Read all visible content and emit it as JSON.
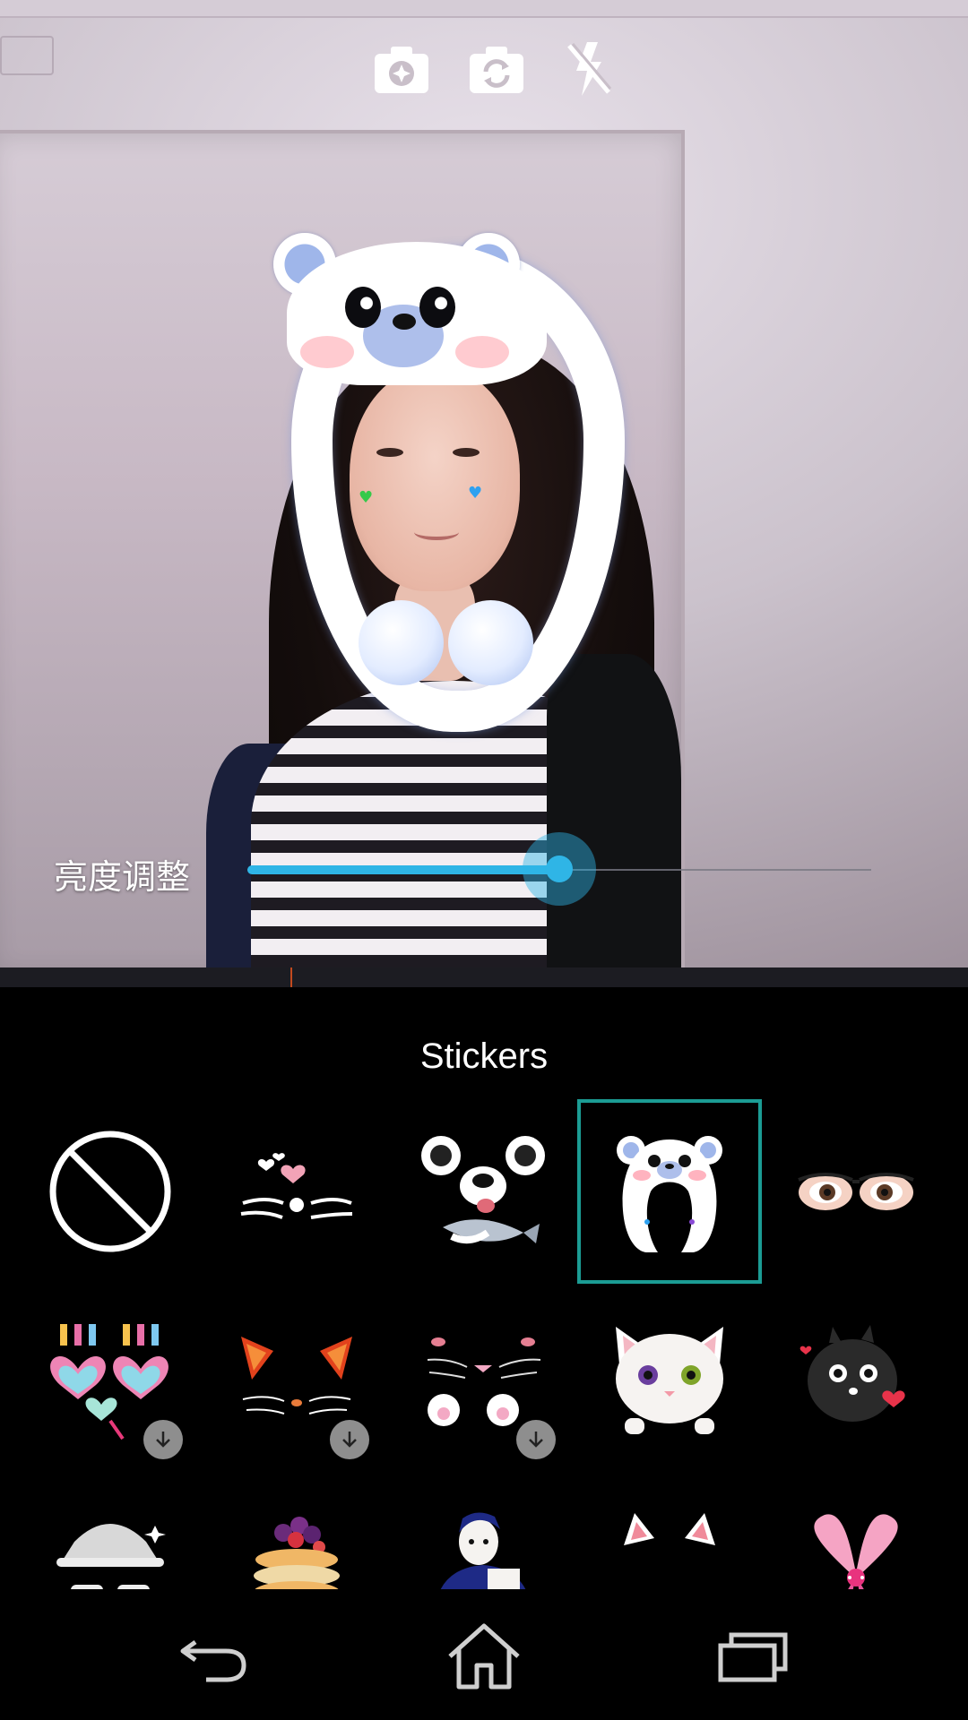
{
  "brightness": {
    "label": "亮度调整",
    "value_percent": 50
  },
  "panel": {
    "title": "Stickers"
  },
  "stickers": [
    {
      "icon": "none-icon",
      "selected": false,
      "download": false
    },
    {
      "icon": "cat-whiskers-hearts-icon",
      "selected": false,
      "download": false
    },
    {
      "icon": "panda-fish-icon",
      "selected": false,
      "download": false
    },
    {
      "icon": "polar-bear-hood-icon",
      "selected": true,
      "download": false
    },
    {
      "icon": "eyes-glasses-icon",
      "selected": false,
      "download": false
    },
    {
      "icon": "birthday-heart-glasses-icon",
      "selected": false,
      "download": true
    },
    {
      "icon": "red-cat-ears-icon",
      "selected": false,
      "download": true
    },
    {
      "icon": "pink-cat-paws-icon",
      "selected": false,
      "download": true
    },
    {
      "icon": "white-cat-face-icon",
      "selected": false,
      "download": false
    },
    {
      "icon": "black-fluffy-creature-icon",
      "selected": false,
      "download": false
    },
    {
      "icon": "bucket-hat-sunglasses-icon",
      "selected": false,
      "download": false
    },
    {
      "icon": "pancake-berries-icon",
      "selected": false,
      "download": false
    },
    {
      "icon": "blue-character-icon",
      "selected": false,
      "download": false
    },
    {
      "icon": "cat-ears-icon",
      "selected": false,
      "download": false
    },
    {
      "icon": "pink-bow-icon",
      "selected": false,
      "download": false
    }
  ],
  "top_controls": [
    "camera-effects-icon",
    "switch-camera-icon",
    "flash-off-icon"
  ],
  "nav": [
    "back-icon",
    "home-icon",
    "recent-apps-icon"
  ],
  "colors": {
    "accent": "#2fb5e6",
    "selection": "#1b9c94"
  }
}
